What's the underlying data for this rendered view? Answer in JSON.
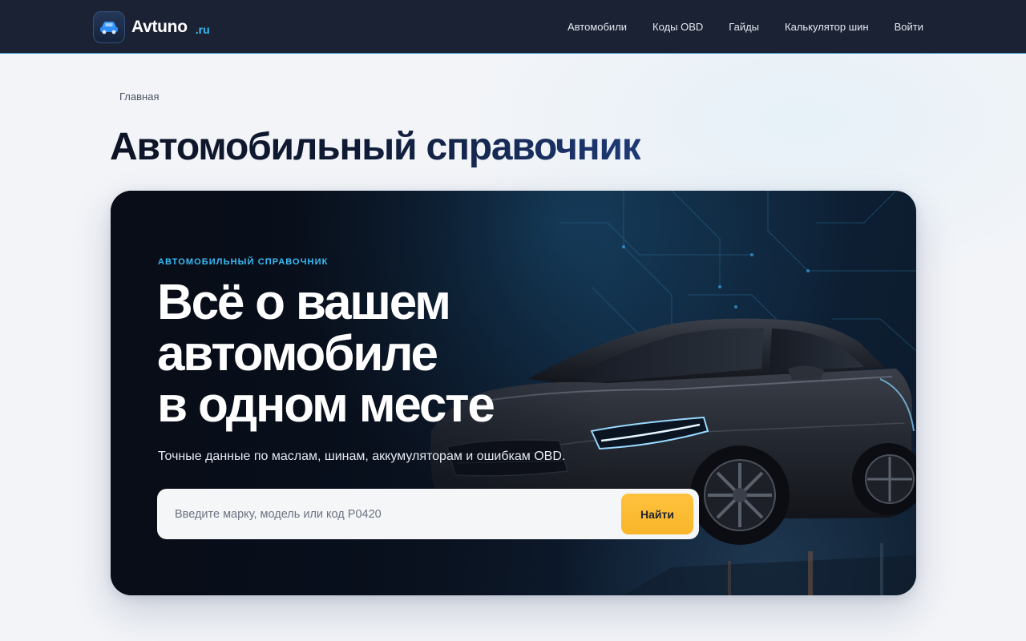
{
  "header": {
    "brand_name": "Avtuno",
    "brand_tld": ".ru",
    "nav": [
      {
        "label": "Автомобили"
      },
      {
        "label": "Коды OBD"
      },
      {
        "label": "Гайды"
      },
      {
        "label": "Калькулятор шин"
      },
      {
        "label": "Войти"
      }
    ]
  },
  "breadcrumb": {
    "home": "Главная"
  },
  "page": {
    "title": "Автомобильный справочник"
  },
  "hero": {
    "eyebrow": "АВТОМОБИЛЬНЫЙ СПРАВОЧНИК",
    "heading_lines": [
      "Всё о вашем",
      "автомобиле",
      "в одном месте"
    ],
    "subtitle": "Точные данные по маслам, шинам, аккумуляторам и ошибкам OBD.",
    "search": {
      "placeholder": "Введите марку, модель или код P0420",
      "value": "",
      "button_label": "Найти"
    }
  },
  "colors": {
    "header_bg": "#1b2233",
    "accent": "#38bdf8",
    "cta": "#fbb930",
    "hero_bg": "#0a1322"
  },
  "icons": {
    "logo": "car-icon"
  }
}
